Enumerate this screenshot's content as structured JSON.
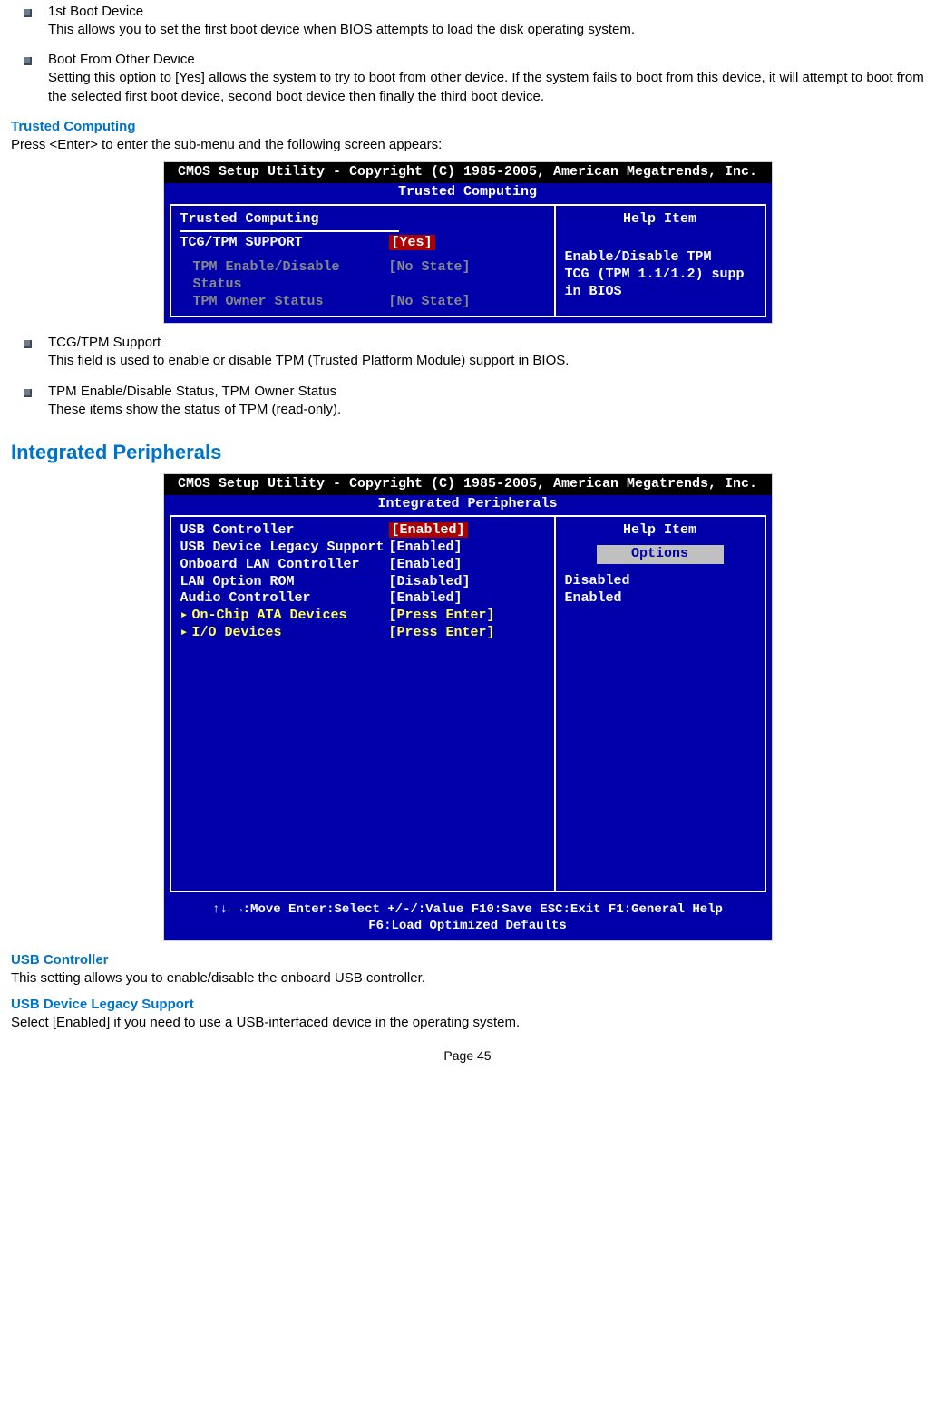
{
  "items": {
    "boot1": {
      "title": "1st Boot Device",
      "desc": "This allows you to set the first boot device when BIOS attempts to load the disk operating system."
    },
    "bootOther": {
      "title": "Boot From Other Device",
      "desc": "Setting this option to [Yes] allows the system to try to boot from other device. If the system fails to boot from this device, it will attempt to boot from the selected first boot device, second boot device then finally the third boot device."
    },
    "tcg": {
      "title": "TCG/TPM Support",
      "desc": "This field is used to enable or disable TPM (Trusted Platform Module) support in BIOS."
    },
    "tpmStatus": {
      "title": "TPM Enable/Disable Status, TPM Owner Status",
      "desc": "These items show the status of TPM (read-only)."
    }
  },
  "headings": {
    "trusted": "Trusted Computing",
    "trustedIntro": "Press <Enter> to enter the sub-menu and the following screen appears:",
    "integrated": "Integrated Peripherals",
    "usbCtrl": "USB Controller",
    "usbCtrlDesc": "This setting allows you to enable/disable the onboard USB controller.",
    "usbLegacy": "USB Device Legacy Support",
    "usbLegacyDesc": "Select [Enabled] if you need to use a USB-interfaced device in the operating system."
  },
  "bios1": {
    "titlebar": "CMOS Setup Utility - Copyright (C) 1985-2005, American Megatrends, Inc.",
    "subtitle": "Trusted Computing",
    "section": "Trusted Computing",
    "row1": {
      "label": "TCG/TPM SUPPORT",
      "value": "[Yes]"
    },
    "row2": {
      "label": "TPM Enable/Disable Status",
      "value": "[No State]"
    },
    "row3": {
      "label": "TPM Owner Status",
      "value": "[No State]"
    },
    "helpTitle": "Help Item",
    "helpText1": "Enable/Disable TPM",
    "helpText2": "TCG (TPM 1.1/1.2) supp",
    "helpText3": "in BIOS"
  },
  "bios2": {
    "titlebar": "CMOS Setup Utility - Copyright (C) 1985-2005, American Megatrends, Inc.",
    "subtitle": "Integrated Peripherals",
    "rows": {
      "r0": {
        "label": "USB Controller",
        "value": "[Enabled]"
      },
      "r1": {
        "label": "USB Device Legacy Support",
        "value": "[Enabled]"
      },
      "r2": {
        "label": "Onboard LAN Controller",
        "value": "[Enabled]"
      },
      "r3": {
        "label": "LAN Option ROM",
        "value": "[Disabled]"
      },
      "r4": {
        "label": "Audio Controller",
        "value": "[Enabled]"
      },
      "r5": {
        "label": "On-Chip ATA Devices",
        "value": "[Press Enter]"
      },
      "r6": {
        "label": "I/O Devices",
        "value": "[Press Enter]"
      }
    },
    "helpTitle": "Help Item",
    "optionsLabel": "Options",
    "opt0": "Disabled",
    "opt1": "Enabled",
    "footer1": "↑↓←→:Move  Enter:Select  +/-/:Value  F10:Save  ESC:Exit  F1:General Help",
    "footer2": "F6:Load Optimized Defaults"
  },
  "page": "Page 45"
}
